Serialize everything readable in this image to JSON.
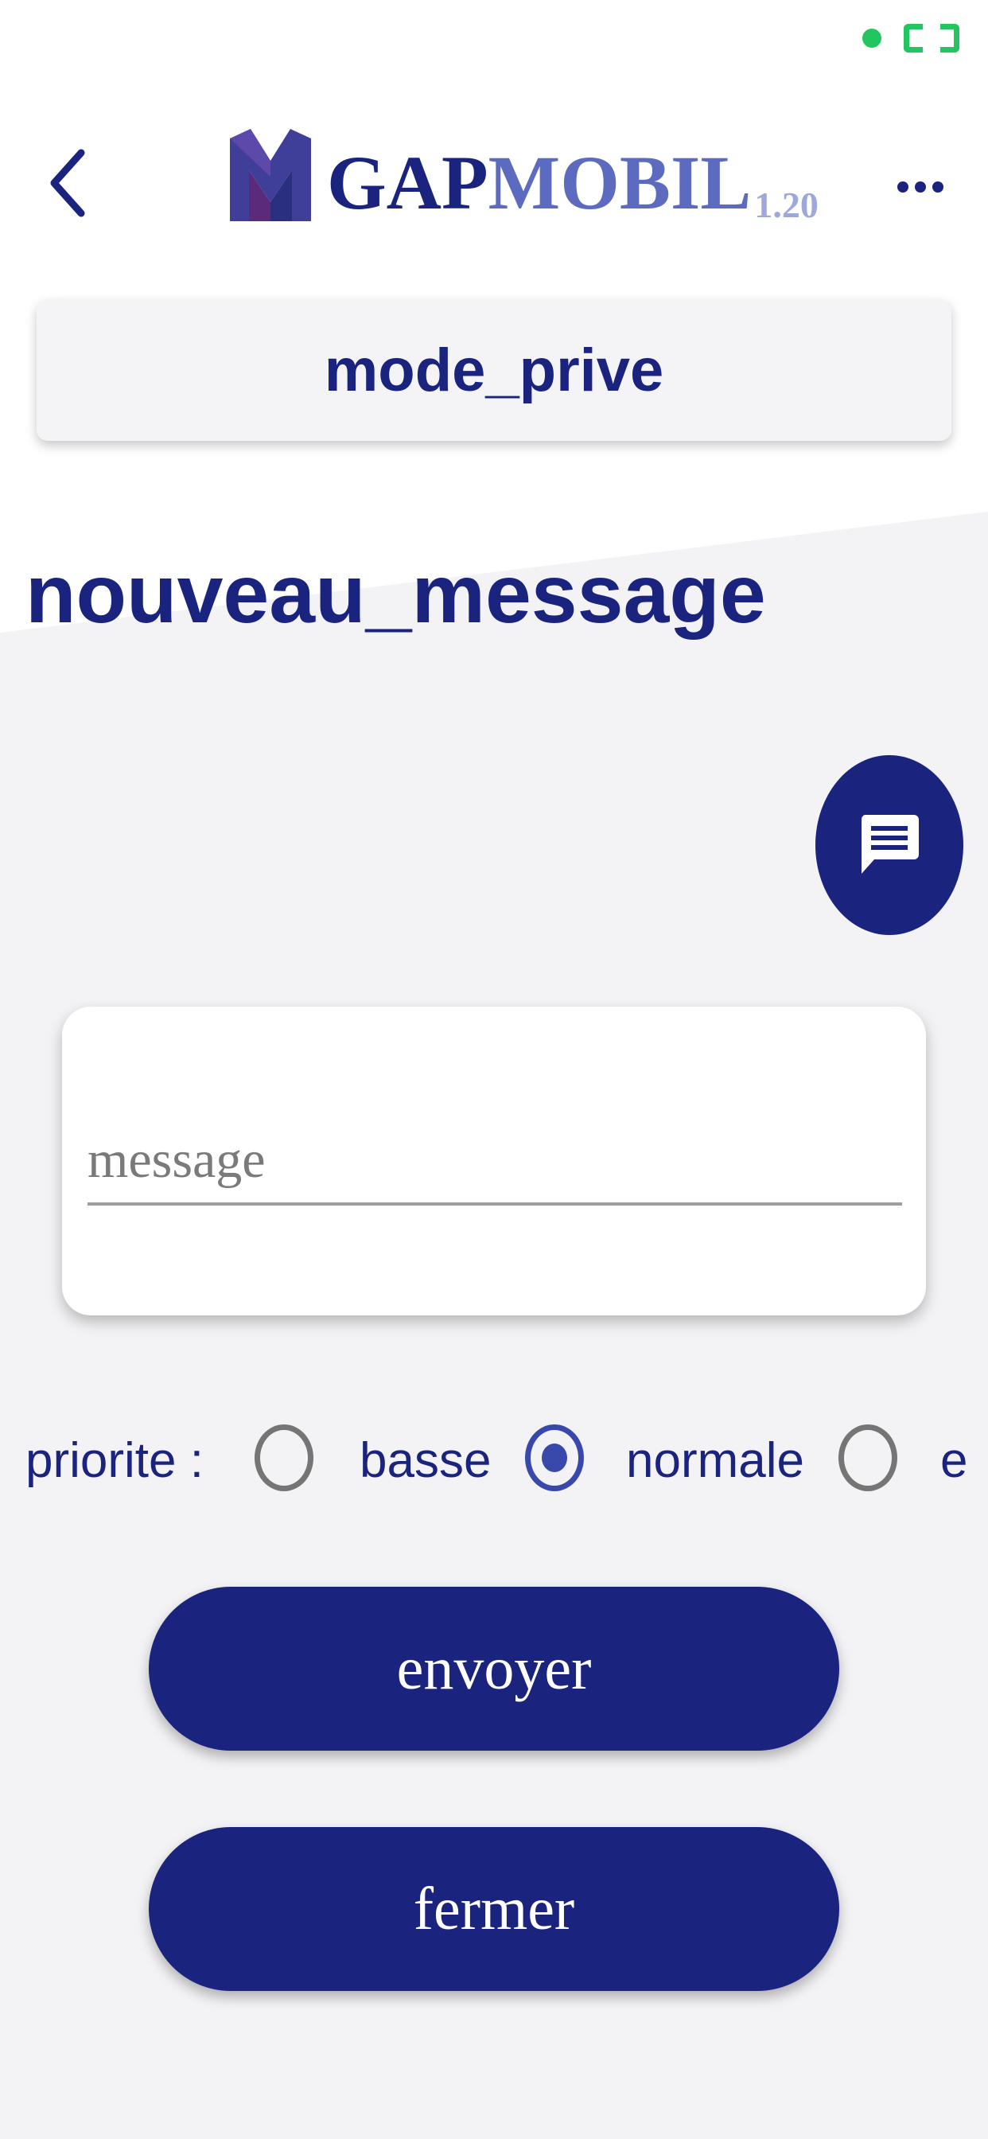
{
  "header": {
    "logo_gap": "GAP",
    "logo_mobil": "MOBIL",
    "logo_version": "1.20"
  },
  "mode": {
    "label": "mode_prive"
  },
  "page": {
    "title": "nouveau_message"
  },
  "message": {
    "placeholder": "message",
    "value": ""
  },
  "priority": {
    "label": "priorite :",
    "options": [
      {
        "label": "basse",
        "checked": false
      },
      {
        "label": "normale",
        "checked": true
      },
      {
        "label": "e",
        "checked": false
      }
    ]
  },
  "buttons": {
    "send": "envoyer",
    "close": "fermer"
  },
  "icons": {
    "back": "chevron-left-icon",
    "more": "more-horizontal-icon",
    "fab": "chat-message-icon",
    "logo": "logo-m-icon"
  },
  "colors": {
    "primary": "#1a237e",
    "accent": "#5c6bc0",
    "version": "#9fa8da",
    "radio_checked": "#3949ab",
    "status": "#22c55e",
    "background": "#f3f3f5"
  }
}
